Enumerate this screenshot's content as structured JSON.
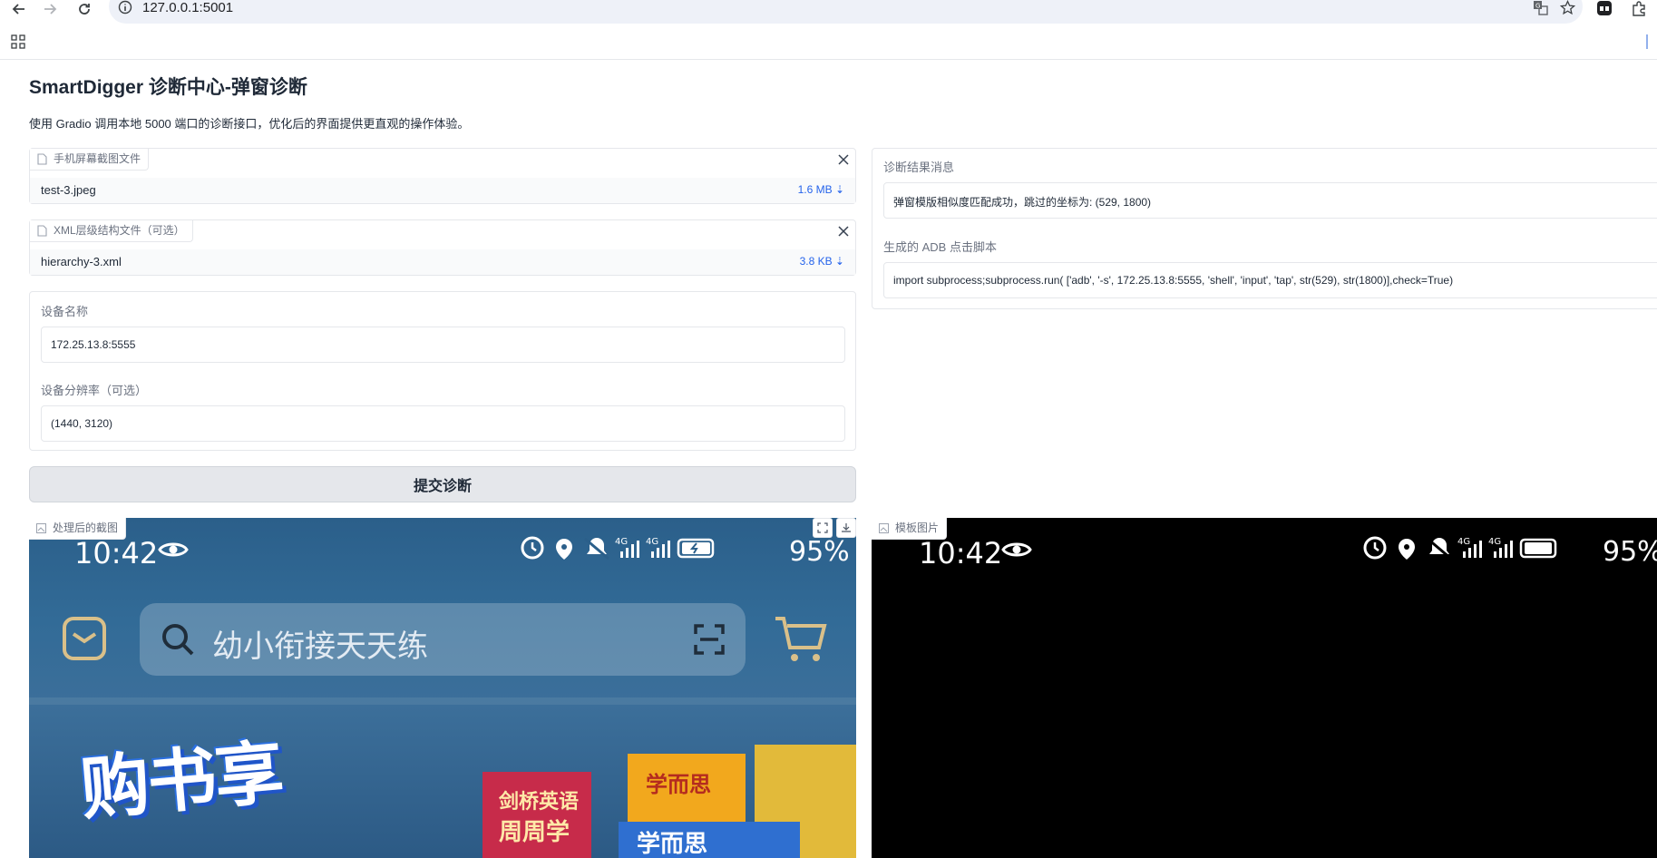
{
  "browser": {
    "url": "127.0.0.1:5001"
  },
  "page": {
    "title": "SmartDigger 诊断中心-弹窗诊断",
    "subtitle": "使用 Gradio 调用本地 5000 端口的诊断接口，优化后的界面提供更直观的操作体验。"
  },
  "screenshot_file": {
    "label": "手机屏幕截图文件",
    "name": "test-3.jpeg",
    "size": "1.6 MB ⇣"
  },
  "xml_file": {
    "label": "XML层级结构文件（可选）",
    "name": "hierarchy-3.xml",
    "size": "3.8 KB ⇣"
  },
  "device": {
    "name_label": "设备名称",
    "name_value": "172.25.13.8:5555",
    "resolution_label": "设备分辨率（可选）",
    "resolution_value": "(1440, 3120)"
  },
  "submit": {
    "label": "提交诊断"
  },
  "result": {
    "message_label": "诊断结果消息",
    "message_value": "弹窗模版相似度匹配成功，跳过的坐标为: (529, 1800)",
    "script_label": "生成的 ADB 点击脚本",
    "script_value": "import subprocess;subprocess.run( ['adb', '-s', 172.25.13.8:5555, 'shell', 'input', 'tap', str(529), str(1800)],check=True)"
  },
  "processed_image": {
    "label": "处理后的截图",
    "status_time": "10:42",
    "status_battery": "95%",
    "search_placeholder": "幼小衔接天天练",
    "promo_text": "购书享"
  },
  "template_image": {
    "label": "模板图片",
    "status_time": "10:42",
    "status_battery": "95%"
  }
}
